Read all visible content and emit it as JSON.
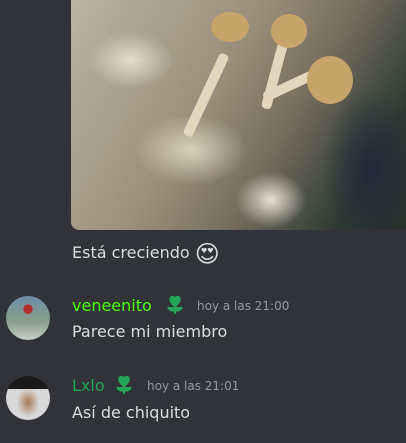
{
  "attachment": {
    "description_icon": "mushroom-photo"
  },
  "messages": [
    {
      "text": "Está creciendo",
      "emoji": "😍"
    },
    {
      "author": "veneenito",
      "author_color": "#4cff00",
      "timestamp": "hoy a las 21:00",
      "text": "Parece mi miembro",
      "badge": "heart-flower-icon"
    },
    {
      "author": "Lxlo",
      "author_color": "#23a55a",
      "timestamp": "hoy a las 21:01",
      "text": "Así de chiquito",
      "badge": "heart-flower-icon"
    }
  ]
}
